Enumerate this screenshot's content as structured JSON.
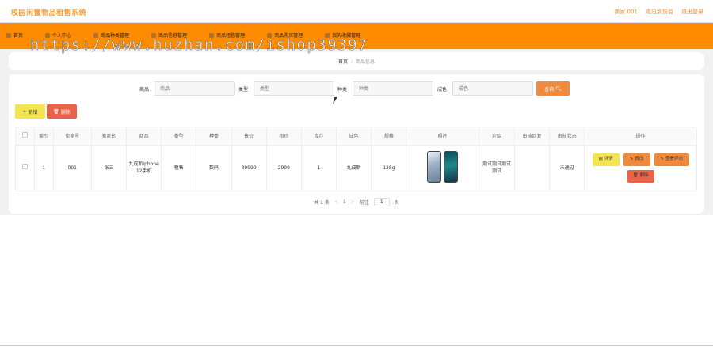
{
  "header": {
    "app_title": "校园闲置物品租售系统",
    "links": [
      "卖家 001",
      "退出到前台",
      "退出登录"
    ]
  },
  "nav": {
    "items": [
      {
        "label": "首页",
        "icon": "home-icon"
      },
      {
        "label": "个人中心",
        "icon": "user-icon"
      },
      {
        "label": "商品种类管理",
        "icon": "category-icon"
      },
      {
        "label": "商品信息管理",
        "icon": "goods-icon"
      },
      {
        "label": "商品租借管理",
        "icon": "rental-icon"
      },
      {
        "label": "商品购买管理",
        "icon": "purchase-icon"
      },
      {
        "label": "我的收藏管理",
        "icon": "favorite-icon"
      }
    ]
  },
  "watermark": "https://www.huzhan.com/ishop39397",
  "breadcrumb": {
    "home": "首页",
    "separator": "/",
    "current": "商品信息"
  },
  "search": {
    "fields": [
      {
        "label": "商品",
        "placeholder": "商品"
      },
      {
        "label": "类型",
        "placeholder": "类型"
      },
      {
        "label": "种类",
        "placeholder": "种类"
      },
      {
        "label": "成色",
        "placeholder": "成色"
      }
    ],
    "button_label": "查询"
  },
  "toolbar": {
    "add_label": "新增",
    "delete_label": "删除"
  },
  "table": {
    "columns": [
      "索引",
      "卖家号",
      "卖家名",
      "商品",
      "类型",
      "种类",
      "售价",
      "租价",
      "库存",
      "成色",
      "规格",
      "照片",
      "介绍",
      "审核回复",
      "审核状态",
      "操作"
    ],
    "rows": [
      {
        "index": "1",
        "seller_no": "001",
        "seller_name": "张三",
        "product": "九成新iphone12手机",
        "type": "租售",
        "category": "数码",
        "price": "39999",
        "rent": "2999",
        "stock": "1",
        "condition": "九成新",
        "spec": "128g",
        "intro": "测试测试测试测试",
        "reply": "",
        "status": "未通过"
      }
    ],
    "actions": {
      "detail": "详情",
      "edit": "修改",
      "review": "查看评论",
      "delete": "删除"
    }
  },
  "pagination": {
    "total": "共 1 条",
    "prev": "<",
    "page": "1",
    "next": ">",
    "goto_label": "前往",
    "goto_value": "1",
    "page_suffix": "页"
  },
  "colors": {
    "brand": "#ff8c00",
    "title": "#f5a13b",
    "search_button": "#f08a3c",
    "add_button": "#f5e451",
    "delete_button": "#e86449"
  }
}
